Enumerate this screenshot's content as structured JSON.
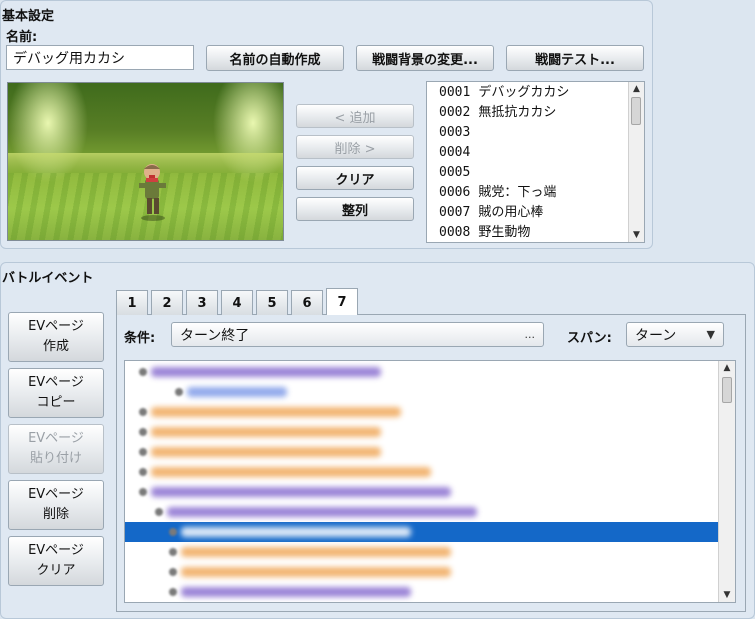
{
  "basic_settings": {
    "section_title": "基本設定",
    "name_label": "名前:",
    "name_value": "デバッグ用カカシ",
    "auto_name_button": "名前の自動作成",
    "change_bg_button": "戦闘背景の変更...",
    "battle_test_button": "戦闘テスト...",
    "add_button": "< 追加",
    "remove_button": "削除 >",
    "clear_button": "クリア",
    "align_button": "整列",
    "troops": [
      {
        "id": "0001",
        "name": "デバッグカカシ"
      },
      {
        "id": "0002",
        "name": "無抵抗カカシ"
      },
      {
        "id": "0003",
        "name": ""
      },
      {
        "id": "0004",
        "name": ""
      },
      {
        "id": "0005",
        "name": ""
      },
      {
        "id": "0006",
        "name": "賊党：下っ端"
      },
      {
        "id": "0007",
        "name": "賊の用心棒"
      },
      {
        "id": "0008",
        "name": "野生動物"
      }
    ]
  },
  "battle_event": {
    "section_title": "バトルイベント",
    "buttons": {
      "create": [
        "EVページ",
        "作成"
      ],
      "copy": [
        "EVページ",
        "コピー"
      ],
      "paste": [
        "EVページ",
        "貼り付け"
      ],
      "delete": [
        "EVページ",
        "削除"
      ],
      "clear": [
        "EVページ",
        "クリア"
      ]
    },
    "tabs": [
      "1",
      "2",
      "3",
      "4",
      "5",
      "6",
      "7"
    ],
    "active_tab": "7",
    "condition_label": "条件:",
    "condition_value": "ターン終了",
    "condition_ellipsis": "...",
    "span_label": "スパン:",
    "span_value": "ターン",
    "selected_row_index": 8
  },
  "colors": {
    "selection": "#1468c8",
    "blur_purple": "#8a6fd0",
    "blur_blue": "#7f9be8",
    "blur_orange": "#f0a85a"
  }
}
